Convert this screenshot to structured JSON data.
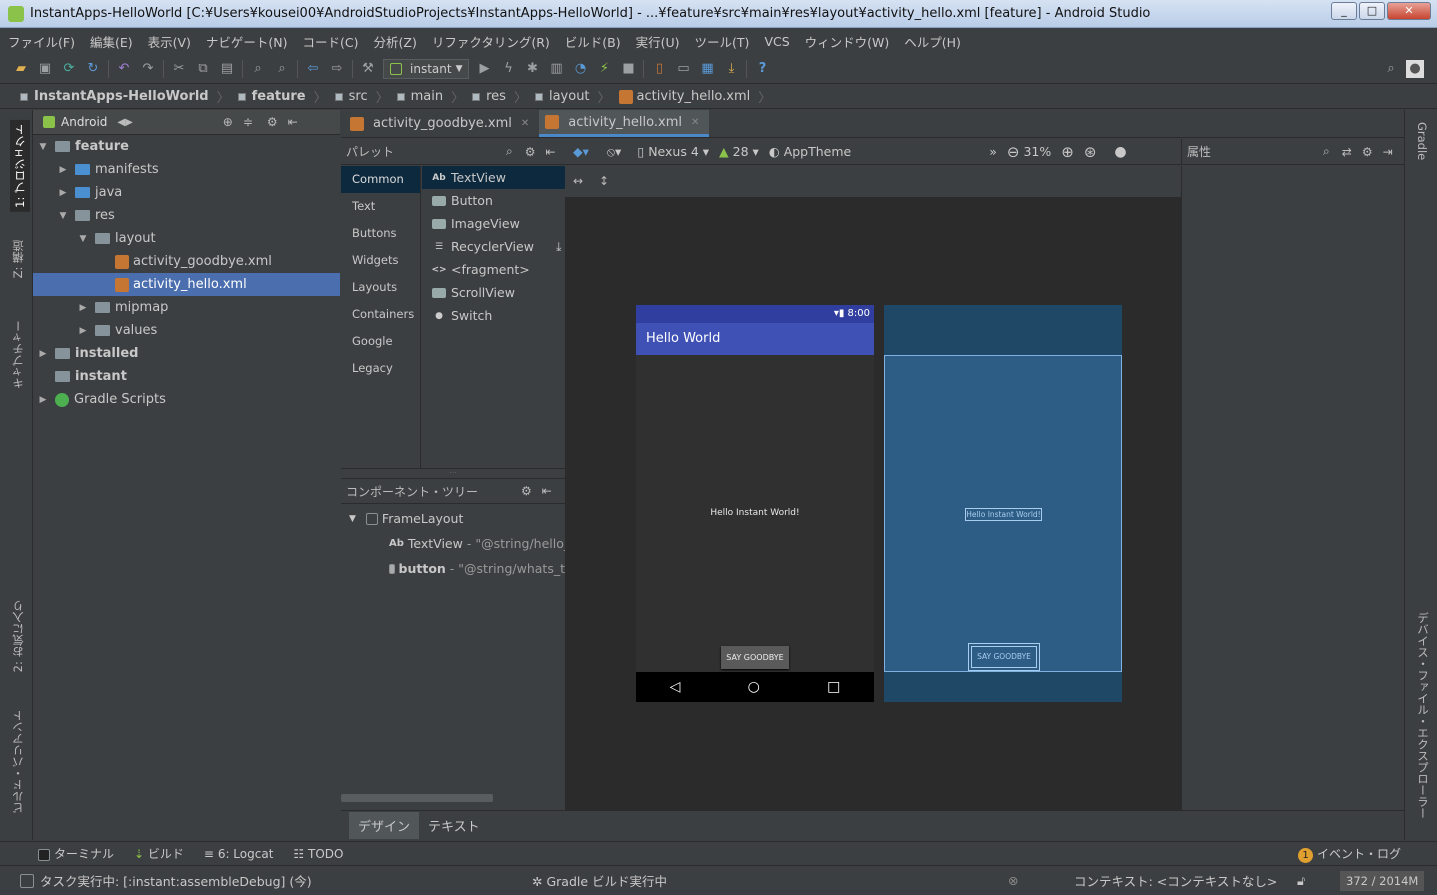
{
  "window": {
    "title": "InstantApps-HelloWorld [C:¥Users¥kousei00¥AndroidStudioProjects¥InstantApps-HelloWorld] - ...¥feature¥src¥main¥res¥layout¥activity_hello.xml [feature] - Android Studio",
    "min": "_",
    "max": "□",
    "close": "✕"
  },
  "menu": [
    "ファイル(F)",
    "編集(E)",
    "表示(V)",
    "ナビゲート(N)",
    "コード(C)",
    "分析(Z)",
    "リファクタリング(R)",
    "ビルド(B)",
    "実行(U)",
    "ツール(T)",
    "VCS",
    "ウィンドウ(W)",
    "ヘルプ(H)"
  ],
  "toolbar": {
    "run_config": "instant",
    "help": "?"
  },
  "breadcrumb": [
    "InstantApps-HelloWorld",
    "feature",
    "src",
    "main",
    "res",
    "layout",
    "activity_hello.xml"
  ],
  "left_tabs": [
    "1: プロジェクト",
    "Z: 構造",
    "キャプチャー",
    "2: お気に入り",
    "ビルド・バリアント"
  ],
  "right_tabs": [
    "Gradle",
    "デバイス・ファイル・エクスプローラー"
  ],
  "project": {
    "view": "Android",
    "tree": [
      {
        "label": "feature",
        "depth": 0,
        "arrow": "▼",
        "bold": true
      },
      {
        "label": "manifests",
        "depth": 1,
        "arrow": "▶"
      },
      {
        "label": "java",
        "depth": 1,
        "arrow": "▶"
      },
      {
        "label": "res",
        "depth": 1,
        "arrow": "▼"
      },
      {
        "label": "layout",
        "depth": 2,
        "arrow": "▼"
      },
      {
        "label": "activity_goodbye.xml",
        "depth": 3,
        "arrow": ""
      },
      {
        "label": "activity_hello.xml",
        "depth": 3,
        "arrow": "",
        "selected": true
      },
      {
        "label": "mipmap",
        "depth": 2,
        "arrow": "▶"
      },
      {
        "label": "values",
        "depth": 2,
        "arrow": "▶"
      },
      {
        "label": "installed",
        "depth": 0,
        "arrow": "▶",
        "bold": true
      },
      {
        "label": "instant",
        "depth": 0,
        "arrow": "",
        "bold": true
      },
      {
        "label": "Gradle Scripts",
        "depth": 0,
        "arrow": "▶"
      }
    ]
  },
  "editor_tabs": [
    {
      "label": "activity_goodbye.xml",
      "active": false
    },
    {
      "label": "activity_hello.xml",
      "active": true
    }
  ],
  "palette": {
    "title": "パレット",
    "categories": [
      "Common",
      "Text",
      "Buttons",
      "Widgets",
      "Layouts",
      "Containers",
      "Google",
      "Legacy"
    ],
    "selected_category": "Common",
    "items": [
      {
        "icon": "Ab",
        "label": "TextView"
      },
      {
        "icon": "",
        "label": "Button"
      },
      {
        "icon": "",
        "label": "ImageView"
      },
      {
        "icon": "☰",
        "label": "RecyclerView"
      },
      {
        "icon": "<>",
        "label": "<fragment>"
      },
      {
        "icon": "",
        "label": "ScrollView"
      },
      {
        "icon": "●",
        "label": "Switch"
      }
    ]
  },
  "component_tree": {
    "title": "コンポーネント・ツリー",
    "root": "FrameLayout",
    "children": [
      {
        "type": "Ab",
        "name": "TextView",
        "value": "- \"@string/hello_"
      },
      {
        "type": "",
        "name": "button",
        "value": "- \"@string/whats_t"
      }
    ]
  },
  "design_bar": {
    "device": "Nexus 4",
    "api": "28",
    "theme": "AppTheme",
    "zoom": "31%"
  },
  "preview": {
    "time": "8:00",
    "app_title": "Hello World",
    "hello_text": "Hello Instant World!",
    "button_label": "SAY GOODBYE",
    "nav": [
      "◁",
      "○",
      "□"
    ]
  },
  "attributes_title": "属性",
  "bottom_tabs": [
    {
      "label": "デザイン",
      "active": true
    },
    {
      "label": "テキスト",
      "active": false
    }
  ],
  "tool_windows": [
    "ターミナル",
    "ビルド",
    "6: Logcat",
    "TODO"
  ],
  "event_log": "イベント・ログ",
  "event_badge": "1",
  "status": {
    "task": "タスク実行中: [:instant:assembleDebug] (今)",
    "gradle": "Gradle ビルド実行中",
    "context": "コンテキスト: <コンテキストなし>",
    "memory": "372 / 2014M"
  }
}
